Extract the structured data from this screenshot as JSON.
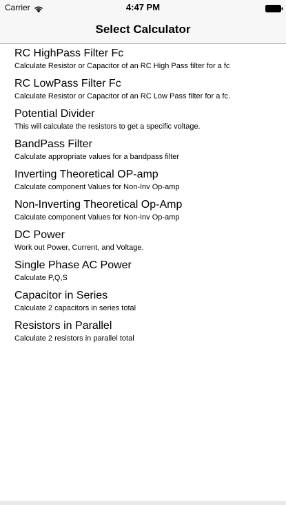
{
  "status_bar": {
    "carrier": "Carrier",
    "time": "4:47 PM",
    "wifi_icon": "wifi-icon",
    "battery_icon": "battery-icon"
  },
  "nav": {
    "title": "Select Calculator"
  },
  "items": [
    {
      "title": "RC HighPass Filter Fc",
      "subtitle": "Calculate Resistor or Capacitor of an RC High Pass filter for a fc"
    },
    {
      "title": "RC LowPass Filter Fc",
      "subtitle": "Calculate Resistor or Capacitor of an RC Low Pass filter for a fc."
    },
    {
      "title": "Potential Divider",
      "subtitle": "This will calculate the resistors to get a specific voltage."
    },
    {
      "title": "BandPass Filter",
      "subtitle": "Calculate appropriate values for a bandpass filter"
    },
    {
      "title": "Inverting Theoretical OP-amp",
      "subtitle": "Calculate component Values for Non-Inv Op-amp"
    },
    {
      "title": "Non-Inverting Theoretical Op-Amp",
      "subtitle": "Calculate component Values for Non-Inv Op-amp"
    },
    {
      "title": "DC Power",
      "subtitle": "Work out Power, Current, and Voltage."
    },
    {
      "title": "Single Phase AC Power",
      "subtitle": "Calculate P,Q,S"
    },
    {
      "title": "Capacitor in Series",
      "subtitle": "Calculate 2 capacitors in series total"
    },
    {
      "title": "Resistors in Parallel",
      "subtitle": "Calculate 2 resistors in parallel total"
    }
  ]
}
